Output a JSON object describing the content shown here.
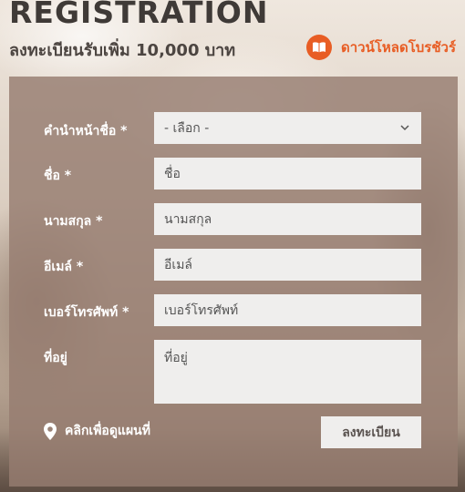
{
  "header": {
    "title": "REGISTRATION",
    "subtitle": "ลงทะเบียนรับเพิ่ม 10,000 บาท",
    "brochure_label": "ดาวน์โหลดโบรชัวร์",
    "brochure_icon": "book-icon",
    "accent_color": "#e85d24"
  },
  "form": {
    "fields": [
      {
        "label": "คำนำหน้าชื่อ *",
        "type": "select",
        "value": "- เลือก -"
      },
      {
        "label": "ชื่อ *",
        "type": "text",
        "placeholder": "ชื่อ"
      },
      {
        "label": "นามสกุล *",
        "type": "text",
        "placeholder": "นามสกุล"
      },
      {
        "label": "อีเมล์ *",
        "type": "text",
        "placeholder": "อีเมล์"
      },
      {
        "label": "เบอร์โทรศัพท์ *",
        "type": "text",
        "placeholder": "เบอร์โทรศัพท์"
      },
      {
        "label": "ที่อยู่",
        "type": "textarea",
        "placeholder": "ที่อยู่"
      }
    ],
    "map_label": "คลิกเพื่อดูแผนที่",
    "map_icon": "map-pin-icon",
    "submit_label": "ลงทะเบียน"
  }
}
